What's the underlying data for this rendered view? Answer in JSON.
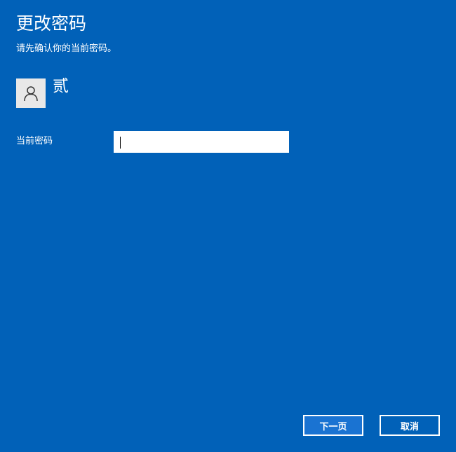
{
  "header": {
    "title": "更改密码",
    "subtitle": "请先确认你的当前密码。"
  },
  "user": {
    "avatar_icon": "user-person-icon",
    "name": "贰"
  },
  "form": {
    "current_password_label": "当前密码",
    "current_password_value": "",
    "current_password_placeholder": ""
  },
  "buttons": {
    "next_label": "下一页",
    "cancel_label": "取消"
  },
  "colors": {
    "background": "#0161b8",
    "primary_button": "#1a73d2",
    "avatar_bg": "#e8e8e8"
  }
}
